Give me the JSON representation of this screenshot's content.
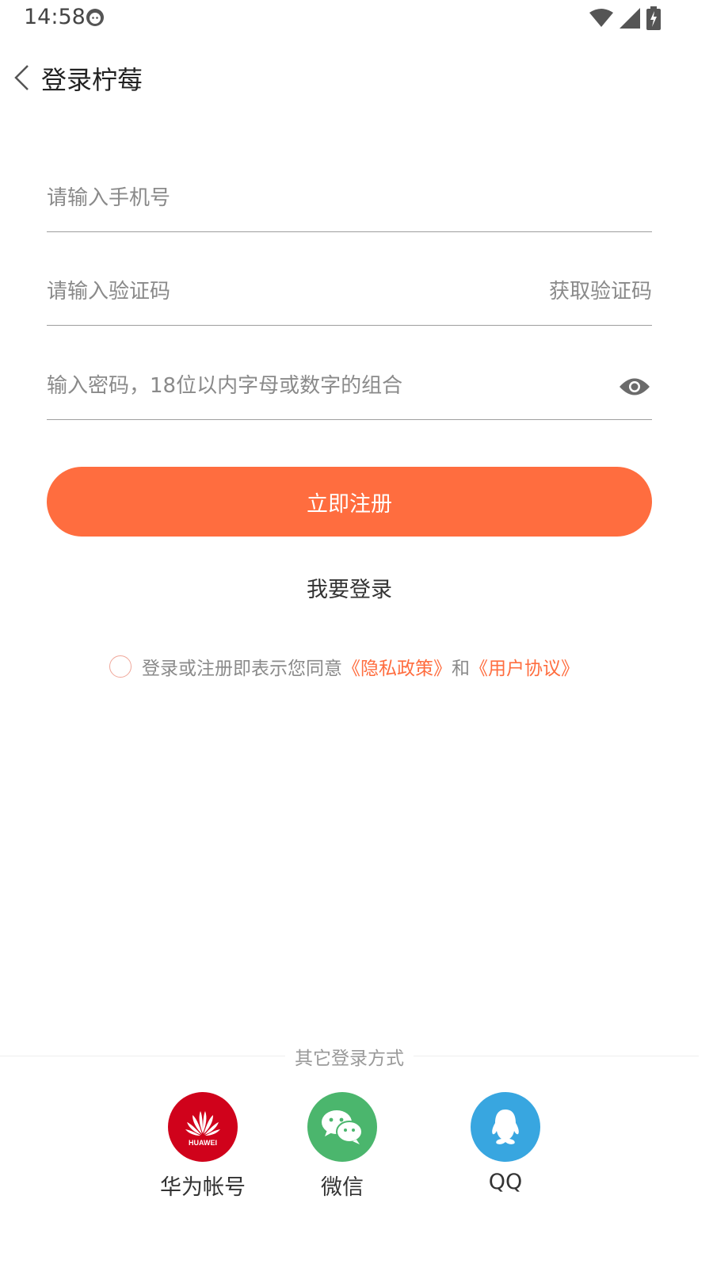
{
  "status_bar": {
    "time": "14:58"
  },
  "nav": {
    "title": "登录柠莓"
  },
  "form": {
    "phone_placeholder": "请输入手机号",
    "code_placeholder": "请输入验证码",
    "get_code": "获取验证码",
    "password_placeholder": "输入密码，18位以内字母或数字的组合"
  },
  "actions": {
    "register": "立即注册",
    "login": "我要登录"
  },
  "agreement": {
    "prefix": "登录或注册即表示您同意",
    "privacy": "《隐私政策》",
    "and": "和",
    "terms": "《用户协议》"
  },
  "other_login": {
    "label": "其它登录方式",
    "options": [
      {
        "label": "华为帐号",
        "icon": "huawei-icon",
        "color": "#d0021b"
      },
      {
        "label": "微信",
        "icon": "wechat-icon",
        "color": "#4bb66d"
      },
      {
        "label": "QQ",
        "icon": "qq-icon",
        "color": "#38a6e0"
      }
    ]
  },
  "colors": {
    "accent": "#ff6d3f"
  }
}
